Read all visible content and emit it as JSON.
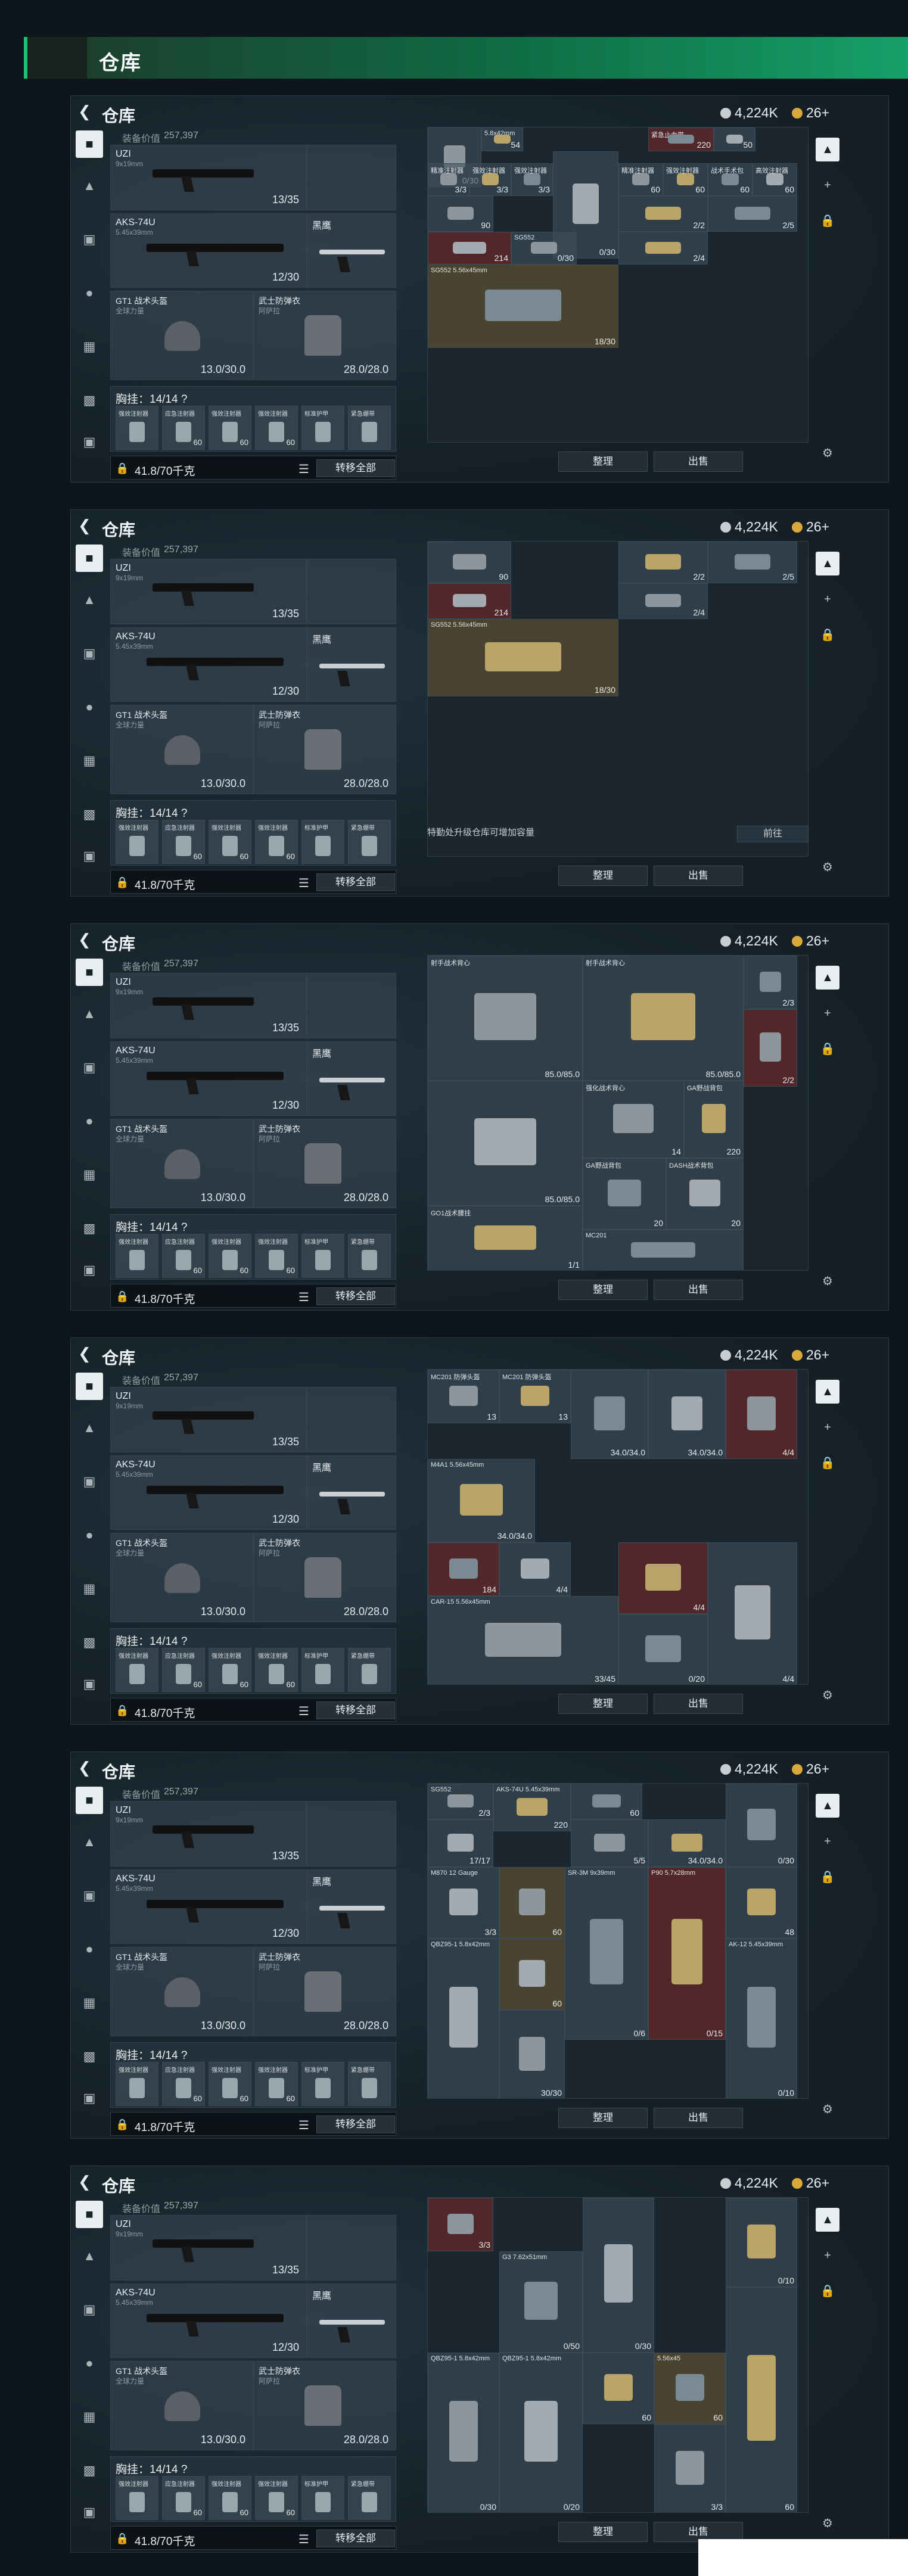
{
  "header": {
    "title": "仓库"
  },
  "panels": [
    {
      "id": "p1"
    },
    {
      "id": "p2"
    },
    {
      "id": "p3"
    },
    {
      "id": "p4"
    },
    {
      "id": "p5"
    },
    {
      "id": "p6"
    }
  ],
  "panel": {
    "title": "仓库",
    "currency_silver": "4,224K",
    "currency_gold": "26+",
    "equip_value_label": "装备价值",
    "equip_value": "257,397",
    "uzi": {
      "name": "UZI",
      "sub": "9x19mm",
      "durability": "13/35"
    },
    "aks": {
      "name": "AKS-74U",
      "sub": "5.45x39mm",
      "durability": "12/30",
      "knife": "黑鹰"
    },
    "helmet": {
      "name": "GT1 战术头盔",
      "sub": "全球力量",
      "durability": "13.0/30.0"
    },
    "armor": {
      "name": "武士防弹衣",
      "sub": "阿萨拉",
      "durability": "28.0/28.0"
    },
    "chest": {
      "label": "胸挂：14/14 ?",
      "cells": [
        {
          "name": "强效注射器",
          "count": ""
        },
        {
          "name": "应急注射器",
          "count": "60"
        },
        {
          "name": "强效注射器",
          "count": "60"
        },
        {
          "name": "强效注射器",
          "count": "60"
        },
        {
          "name": "标准护甲",
          "count": ""
        },
        {
          "name": "紧急绷带",
          "count": ""
        }
      ]
    },
    "weight": "41.8/70千克",
    "transfer_all": "转移全部",
    "sort": "整理",
    "sell": "出售",
    "expand_hint": "特勤处升级仓库可增加容量",
    "go": "前往"
  },
  "stash": {
    "p1": [
      {
        "n": "",
        "c": "0/30"
      },
      {
        "n": "5.8x42mm",
        "c": "54"
      },
      {
        "n": "紧急止血带",
        "c": "220"
      },
      {
        "n": "",
        "c": "50"
      },
      {
        "n": "精准注射器",
        "c": "3/3"
      },
      {
        "n": "强效注射器",
        "c": "3/3"
      },
      {
        "n": "强效注射器",
        "c": "3/3"
      },
      {
        "n": "",
        "c": "0/30"
      },
      {
        "n": "精准注射器",
        "c": "60"
      },
      {
        "n": "强效注射器",
        "c": "60"
      },
      {
        "n": "战术手术包",
        "c": "60"
      },
      {
        "n": "高效注射器",
        "c": "60"
      },
      {
        "n": "",
        "c": "90"
      },
      {
        "n": "",
        "c": "2/2"
      },
      {
        "n": "",
        "c": "2/5"
      },
      {
        "n": "",
        "c": "214"
      },
      {
        "n": "SG552",
        "c": "0/30"
      },
      {
        "n": "",
        "c": "2/4"
      },
      {
        "n": "SG552 5.56x45mm",
        "c": "18/30"
      }
    ],
    "p2": [
      {
        "n": "",
        "c": "90"
      },
      {
        "n": "",
        "c": "2/2"
      },
      {
        "n": "",
        "c": "2/5"
      },
      {
        "n": "",
        "c": "214"
      },
      {
        "n": "",
        "c": "2/4"
      },
      {
        "n": "SG552 5.56x45mm",
        "c": "18/30"
      }
    ],
    "p3": [
      {
        "n": "射手战术背心",
        "c": "85.0/85.0"
      },
      {
        "n": "射手战术背心",
        "c": "85.0/85.0"
      },
      {
        "n": "",
        "c": "2/3"
      },
      {
        "n": "",
        "c": "85.0/85.0"
      },
      {
        "n": "强化战术背心",
        "c": "14"
      },
      {
        "n": "GA野战背包",
        "c": "220"
      },
      {
        "n": "GA野战背包",
        "c": "20"
      },
      {
        "n": "DASH战术背包",
        "c": "20"
      },
      {
        "n": "",
        "c": "2/2"
      },
      {
        "n": "GO1战术腰挂",
        "c": "1/1"
      },
      {
        "n": "MC201",
        "c": ""
      }
    ],
    "p4": [
      {
        "n": "MC201 防弹头盔",
        "c": "13"
      },
      {
        "n": "MC201 防弹头盔",
        "c": "13"
      },
      {
        "n": "",
        "c": "34.0/34.0"
      },
      {
        "n": "",
        "c": "34.0/34.0"
      },
      {
        "n": "",
        "c": "4/4"
      },
      {
        "n": "M4A1 5.56x45mm",
        "c": "34.0/34.0"
      },
      {
        "n": "",
        "c": "184"
      },
      {
        "n": "",
        "c": "4/4"
      },
      {
        "n": "CAR-15 5.56x45mm",
        "c": "33/45"
      },
      {
        "n": "",
        "c": "4/4"
      },
      {
        "n": "",
        "c": "0/20"
      },
      {
        "n": "",
        "c": "4/4"
      }
    ],
    "p5": [
      {
        "n": "SG552",
        "c": "2/3"
      },
      {
        "n": "AKS-74U 5.45x39mm",
        "c": "220"
      },
      {
        "n": "",
        "c": "60"
      },
      {
        "n": "",
        "c": "17/17"
      },
      {
        "n": "",
        "c": "5/5"
      },
      {
        "n": "",
        "c": "34.0/34.0"
      },
      {
        "n": "",
        "c": "0/30"
      },
      {
        "n": "M870 12 Gauge",
        "c": "3/3"
      },
      {
        "n": "",
        "c": "60"
      },
      {
        "n": "",
        "c": "48"
      },
      {
        "n": "SR-3M 9x39mm",
        "c": "0/6"
      },
      {
        "n": "",
        "c": "60"
      },
      {
        "n": "",
        "c": "30/30"
      },
      {
        "n": "P90 5.7x28mm",
        "c": "0/15"
      },
      {
        "n": "AK-12 5.45x39mm",
        "c": "0/10"
      },
      {
        "n": "QBZ95-1 5.8x42mm",
        "c": ""
      }
    ],
    "p6": [
      {
        "n": "",
        "c": "3/3"
      },
      {
        "n": "",
        "c": "0/10"
      },
      {
        "n": "G3 7.62x51mm",
        "c": "0/50"
      },
      {
        "n": "",
        "c": "0/30"
      },
      {
        "n": "QBZ95-1 5.8x42mm",
        "c": "0/30"
      },
      {
        "n": "",
        "c": "60"
      },
      {
        "n": "5.56x45",
        "c": "60"
      },
      {
        "n": "QBZ95-1 5.8x42mm",
        "c": "0/20"
      },
      {
        "n": "",
        "c": "3/3"
      },
      {
        "n": "",
        "c": "60"
      }
    ]
  }
}
